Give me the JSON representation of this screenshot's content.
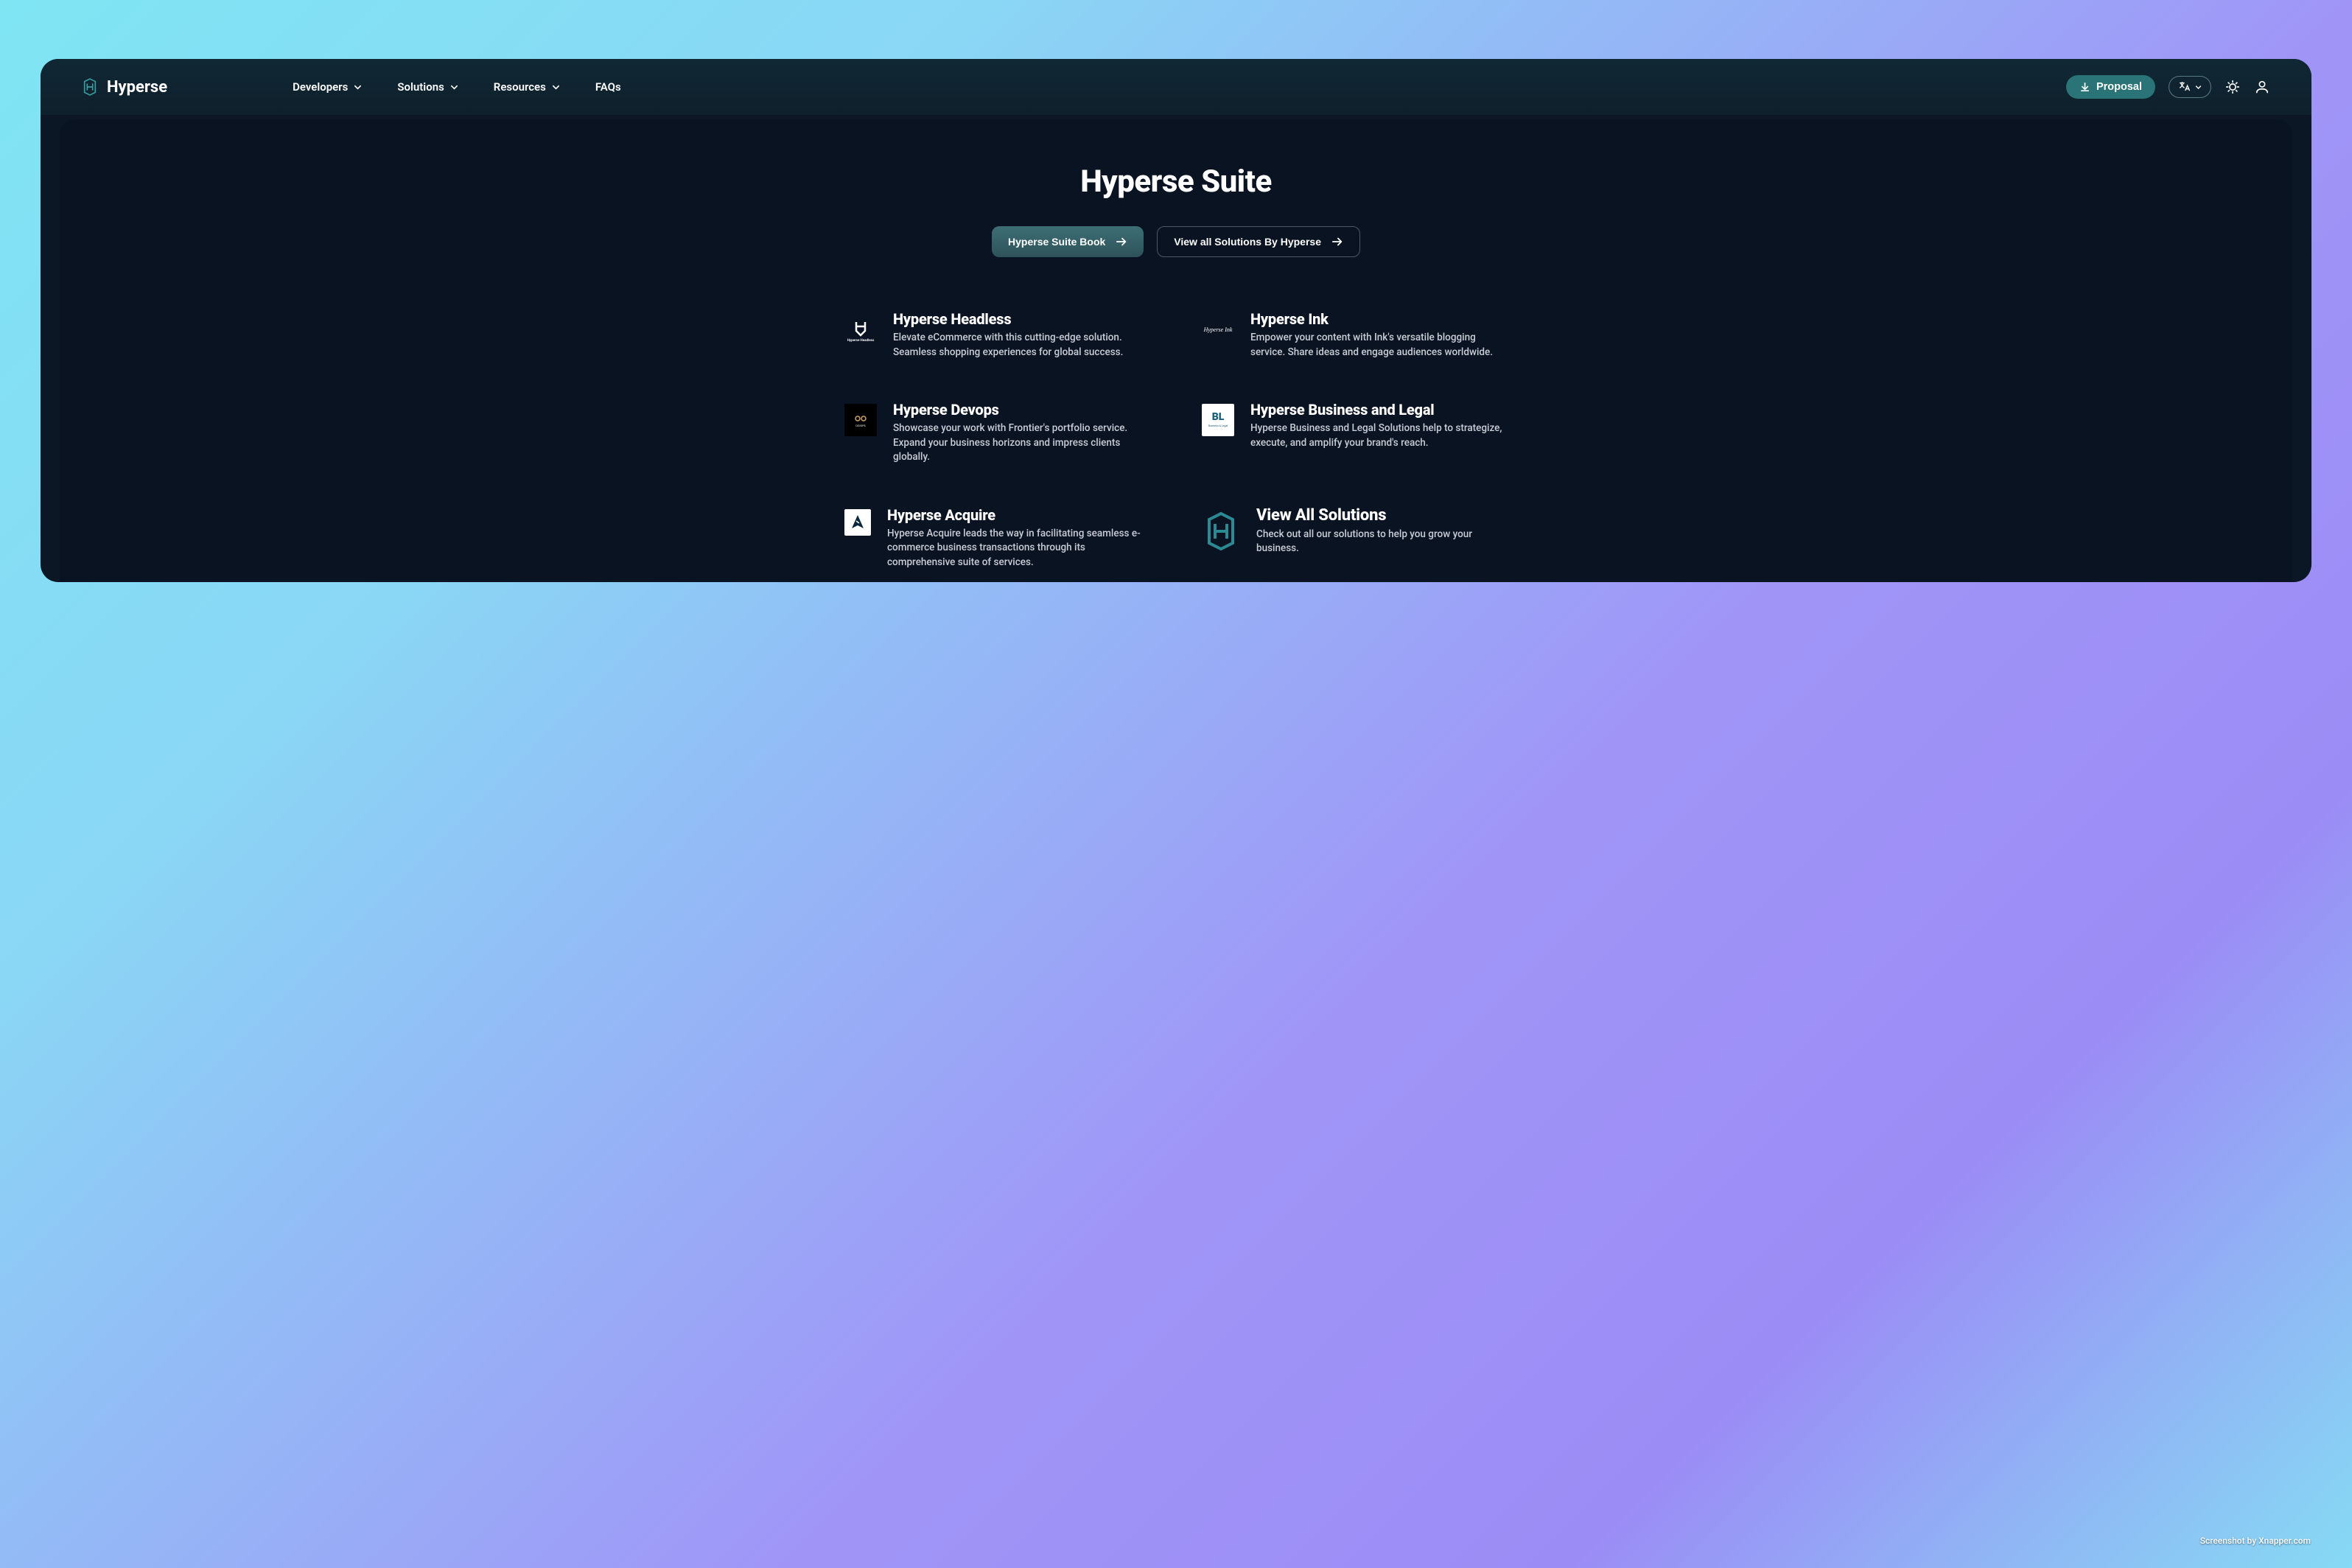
{
  "brand": {
    "name": "Hyperse"
  },
  "nav": {
    "items": [
      {
        "label": "Developers"
      },
      {
        "label": "Solutions"
      },
      {
        "label": "Resources"
      },
      {
        "label": "FAQs"
      }
    ]
  },
  "header": {
    "proposal_label": "Proposal"
  },
  "hero": {
    "title": "Hyperse Suite",
    "primary_label": "Hyperse Suite Book",
    "secondary_label": "View all Solutions By Hyperse"
  },
  "cards": [
    {
      "title": "Hyperse Headless",
      "desc": "Elevate eCommerce with this cutting-edge solution. Seamless shopping experiences for global success."
    },
    {
      "title": "Hyperse Ink",
      "desc": "Empower your content with Ink's versatile blogging service. Share ideas and engage audiences worldwide."
    },
    {
      "title": "Hyperse Devops",
      "desc": "Showcase your work with Frontier's portfolio service. Expand your business horizons and impress clients globally."
    },
    {
      "title": "Hyperse Business and Legal",
      "desc": "Hyperse Business and Legal Solutions help to strategize, execute, and amplify your brand's reach."
    },
    {
      "title": "Hyperse Acquire",
      "desc": "Hyperse Acquire leads the way in facilitating seamless e-commerce business transactions through its comprehensive suite of services."
    },
    {
      "title": "View All Solutions",
      "desc": "Check out all our solutions to help you grow your business."
    }
  ],
  "attribution": "Screenshot by Xnapper.com"
}
